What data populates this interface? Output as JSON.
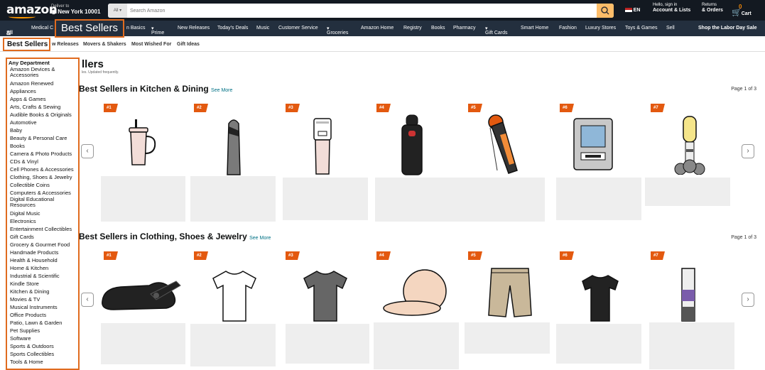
{
  "header": {
    "logo": "amazon",
    "deliver_label": "Deliver to",
    "deliver_location": "New York 10001",
    "search_category": "All",
    "search_placeholder": "Search Amazon",
    "language": "EN",
    "account_hello": "Hello, sign in",
    "account_label": "Account & Lists",
    "returns_label": "Returns",
    "orders_label": "& Orders",
    "cart_count": "0",
    "cart_label": "Cart"
  },
  "nav": {
    "all": "All",
    "items": [
      "Medical C",
      "n Basics",
      "Prime",
      "New Releases",
      "Today's Deals",
      "Music",
      "Customer Service",
      "Groceries",
      "Amazon Home",
      "Registry",
      "Books",
      "Pharmacy",
      "Gift Cards",
      "Smart Home",
      "Fashion",
      "Luxury Stores",
      "Toys & Games",
      "Sell"
    ],
    "promo": "Shop the Labor Day Sale",
    "highlight": "Best Sellers"
  },
  "subnav": {
    "best_sellers": "Best Sellers",
    "items": [
      "w Releases",
      "Movers & Shakers",
      "Most Wished For",
      "Gift Ideas"
    ]
  },
  "sidebar": {
    "heading": "Any Department",
    "items": [
      "Amazon Devices & Accessories",
      "Amazon Renewed",
      "Appliances",
      "Apps & Games",
      "Arts, Crafts & Sewing",
      "Audible Books & Originals",
      "Automotive",
      "Baby",
      "Beauty & Personal Care",
      "Books",
      "Camera & Photo Products",
      "CDs & Vinyl",
      "Cell Phones & Accessories",
      "Clothing, Shoes & Jewelry",
      "Collectible Coins",
      "Computers & Accessories",
      "Digital Educational Resources",
      "Digital Music",
      "Electronics",
      "Entertainment Collectibles",
      "Gift Cards",
      "Grocery & Gourmet Food",
      "Handmade Products",
      "Health & Household",
      "Home & Kitchen",
      "Industrial & Scientific",
      "Kindle Store",
      "Kitchen & Dining",
      "Movies & TV",
      "Musical Instruments",
      "Office Products",
      "Patio, Lawn & Garden",
      "Pet Supplies",
      "Software",
      "Sports & Outdoors",
      "Sports Collectibles",
      "Tools & Home"
    ]
  },
  "main": {
    "page_title": "llers",
    "page_subtitle": "les. Updated frequently.",
    "sections": [
      {
        "title": "Best Sellers in Kitchen & Dining",
        "see_more": "See More",
        "pager": "Page 1 of 3",
        "ranks": [
          "#1",
          "#2",
          "#3",
          "#4",
          "#5",
          "#6",
          "#7"
        ]
      },
      {
        "title": "Best Sellers in Clothing, Shoes & Jewelry",
        "see_more": "See More",
        "pager": "Page 1 of 3",
        "ranks": [
          "#1",
          "#2",
          "#3",
          "#4",
          "#5",
          "#6",
          "#7"
        ]
      }
    ]
  },
  "colors": {
    "nav_dark": "#131921",
    "nav_mid": "#232f3e",
    "accent": "#e3590f",
    "search_btn": "#febd69"
  }
}
